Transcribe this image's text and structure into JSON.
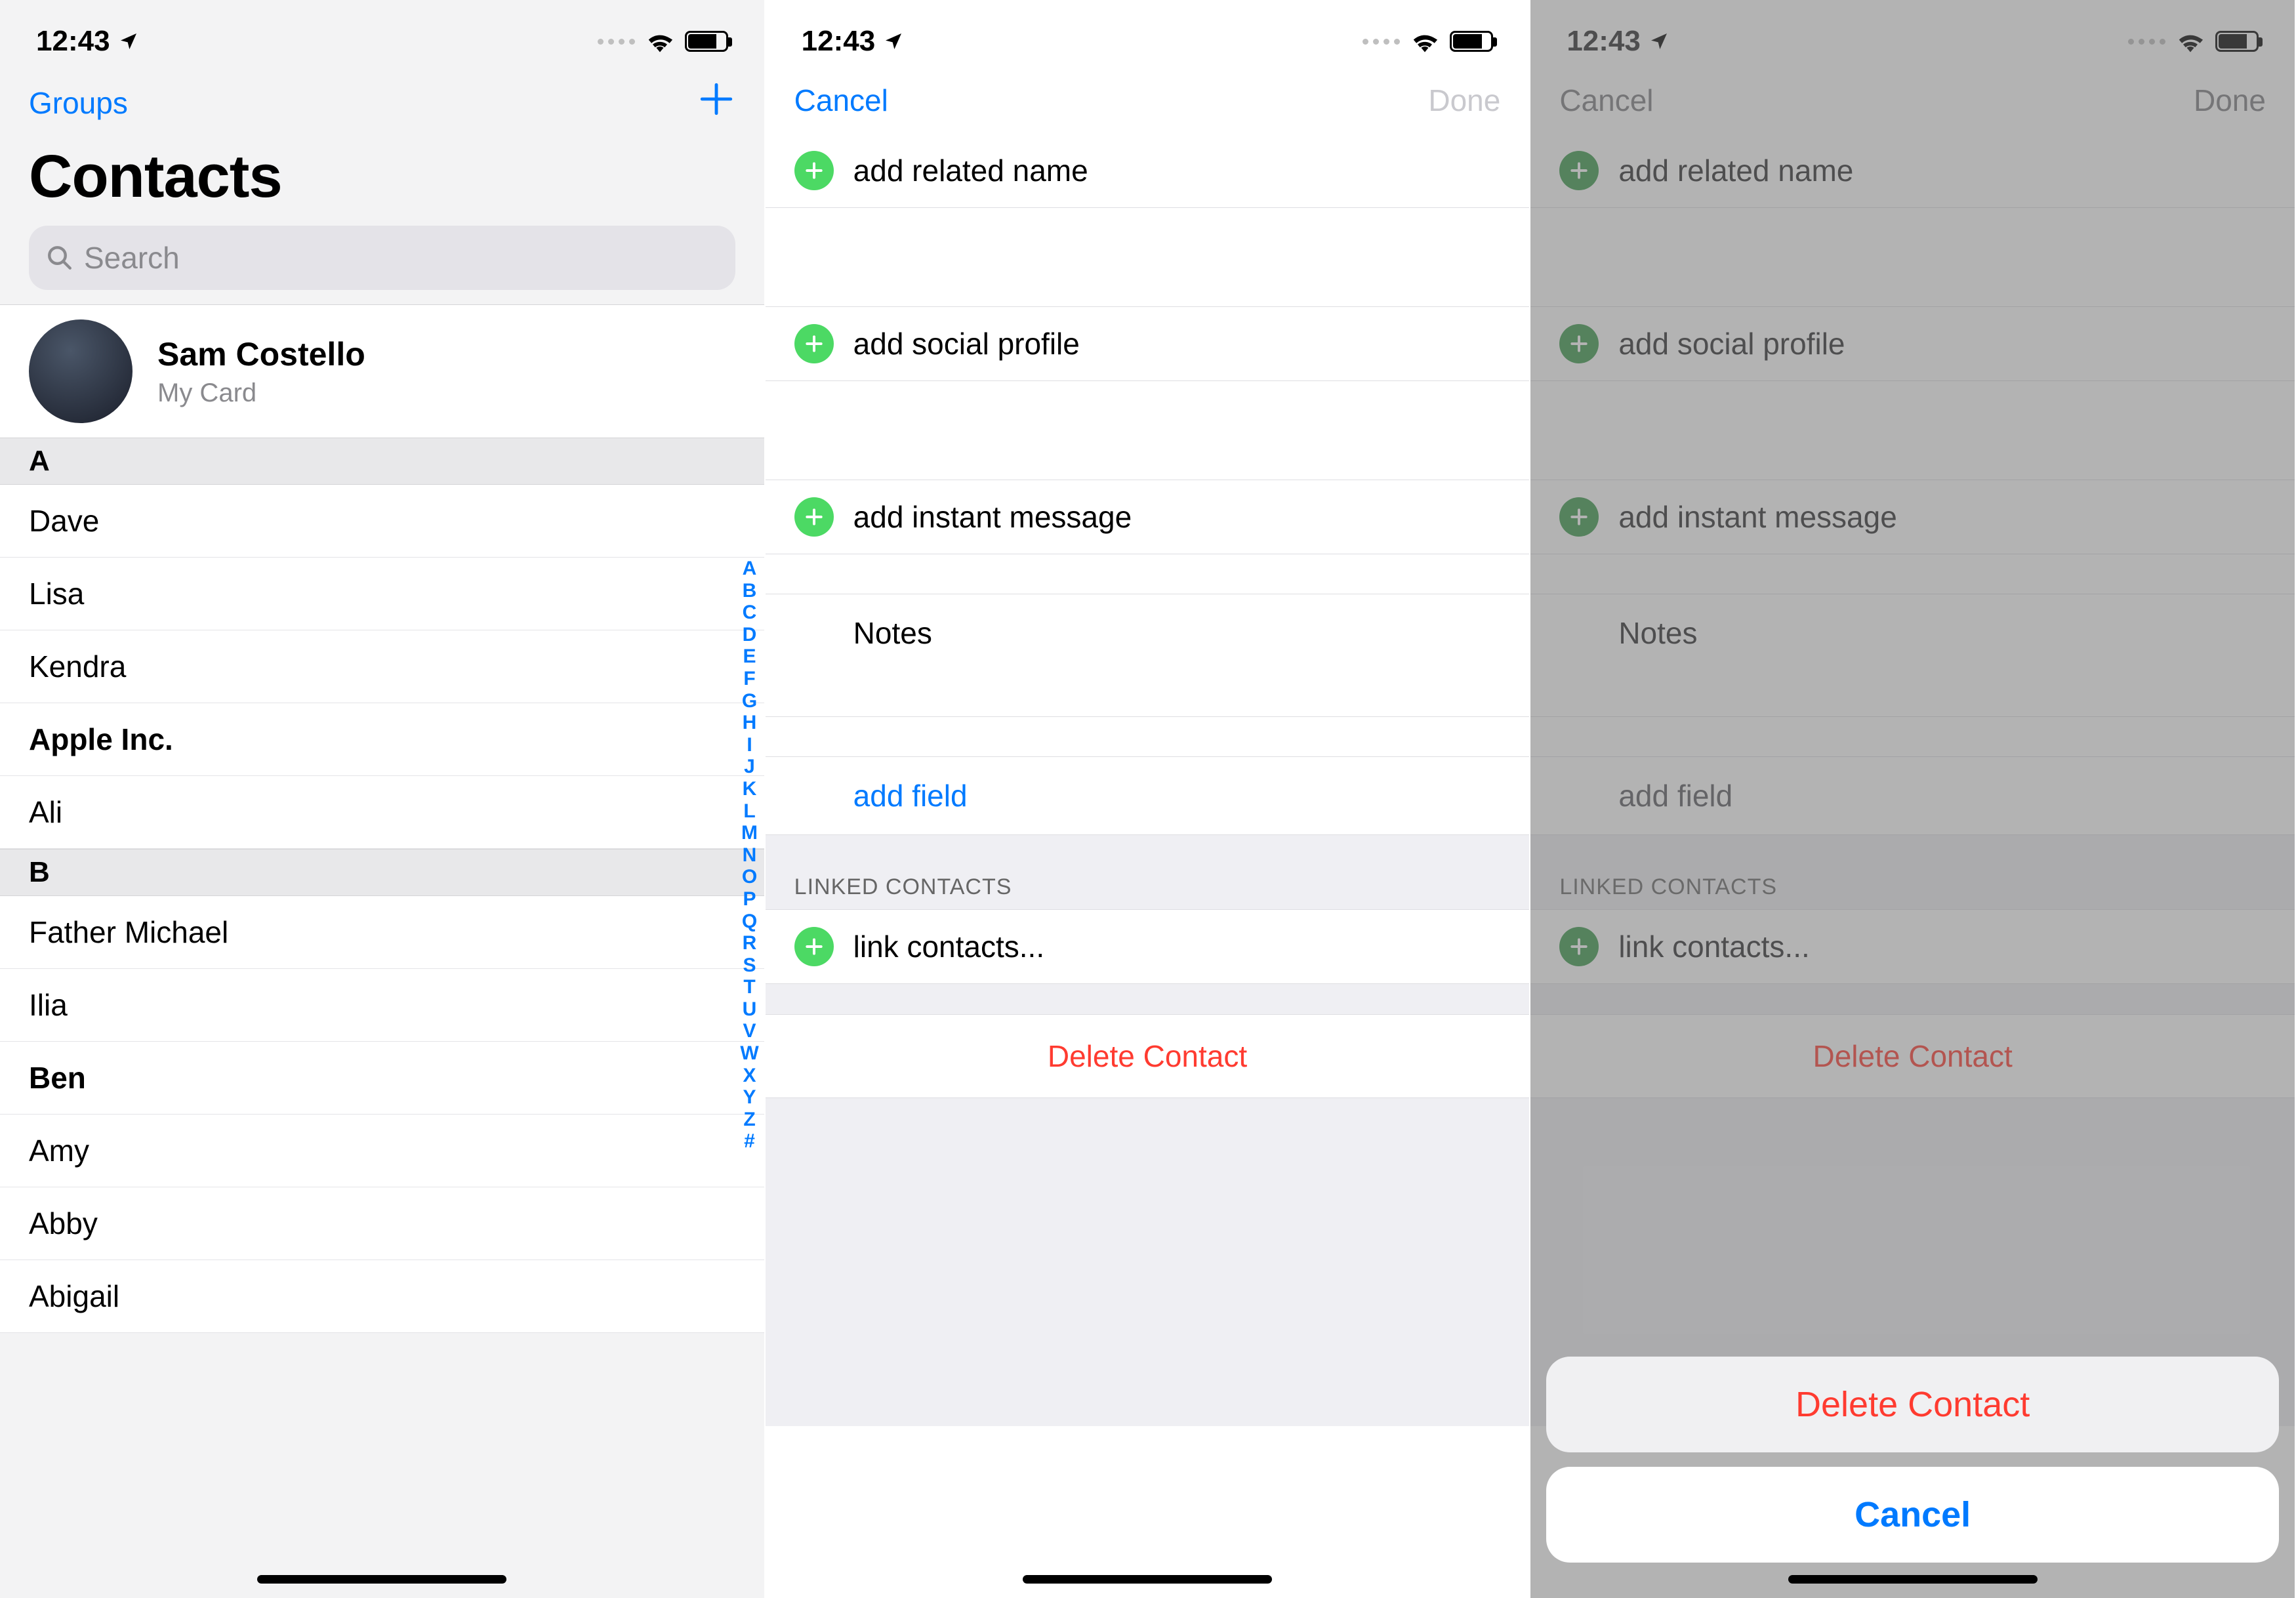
{
  "status": {
    "time": "12:43"
  },
  "screen1": {
    "groups": "Groups",
    "title": "Contacts",
    "search_ph": "Search",
    "me": {
      "name": "Sam Costello",
      "sub": "My Card"
    },
    "sections": [
      {
        "letter": "A",
        "rows": [
          {
            "name": "Dave",
            "bold": false
          },
          {
            "name": "Lisa",
            "bold": false
          },
          {
            "name": "Kendra",
            "bold": false
          },
          {
            "name": "Apple Inc.",
            "bold": true
          },
          {
            "name": "Ali",
            "bold": false
          }
        ]
      },
      {
        "letter": "B",
        "rows": [
          {
            "name": "Father Michael",
            "bold": false
          },
          {
            "name": "Ilia",
            "bold": false
          },
          {
            "name": "Ben",
            "bold": true
          },
          {
            "name": "Amy",
            "bold": false
          },
          {
            "name": "Abby",
            "bold": false
          },
          {
            "name": "Abigail",
            "bold": false
          }
        ]
      }
    ],
    "index": [
      "A",
      "B",
      "C",
      "D",
      "E",
      "F",
      "G",
      "H",
      "I",
      "J",
      "K",
      "L",
      "M",
      "N",
      "O",
      "P",
      "Q",
      "R",
      "S",
      "T",
      "U",
      "V",
      "W",
      "X",
      "Y",
      "Z",
      "#"
    ]
  },
  "edit": {
    "cancel": "Cancel",
    "done": "Done",
    "add_related": "add related name",
    "add_social": "add social profile",
    "add_im": "add instant message",
    "notes": "Notes",
    "add_field": "add field",
    "linked_hdr": "LINKED CONTACTS",
    "link_contacts": "link contacts...",
    "delete": "Delete Contact"
  },
  "sheet": {
    "delete": "Delete Contact",
    "cancel": "Cancel"
  }
}
